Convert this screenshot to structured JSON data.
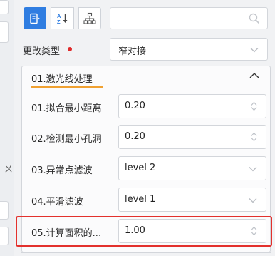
{
  "toolbar": {
    "buttons": [
      {
        "name": "category-view",
        "active": true
      },
      {
        "name": "sort-az",
        "active": false
      },
      {
        "name": "tree-view",
        "active": false
      }
    ],
    "search": {
      "value": "",
      "placeholder": ""
    }
  },
  "change_type": {
    "label": "更改类型",
    "required": true,
    "value": "窄对接"
  },
  "group": {
    "title": "01.激光线处理",
    "expanded": true,
    "properties": [
      {
        "label": "01.拟合最小距离",
        "value": "0.20",
        "control": "stepper"
      },
      {
        "label": "02.检测最小孔洞",
        "value": "0.20",
        "control": "stepper"
      },
      {
        "label": "03.异常点滤波",
        "value": "level 2",
        "control": "dropdown"
      },
      {
        "label": "04.平滑滤波",
        "value": "level 1",
        "control": "dropdown"
      },
      {
        "label": "05.计算面积的...",
        "value": "1.00",
        "control": "stepper",
        "highlighted": true
      }
    ]
  },
  "left_partial": {
    "glyph": "ㄨ"
  },
  "colors": {
    "accent": "#2f7de1",
    "underline": "#f0a131",
    "highlight": "#e3312d",
    "required_dot": "#e02b2b"
  }
}
